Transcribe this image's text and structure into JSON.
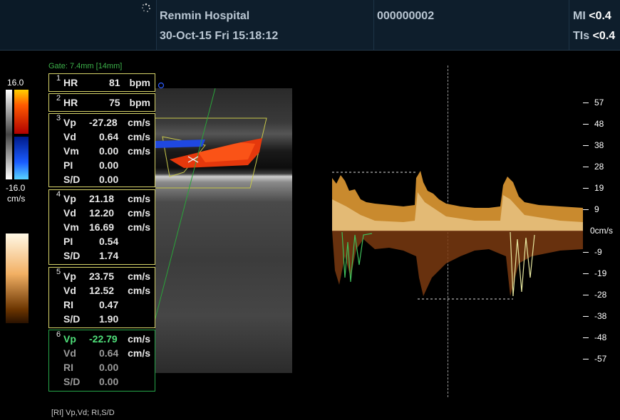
{
  "header": {
    "hospital": "Renmin Hospital",
    "datetime": "30-Oct-15 Fri 15:18:12",
    "patient_id": "000000002",
    "mi_label": "MI",
    "mi_value": "<0.4",
    "tis_label": "TIs",
    "tis_value": "<0.4"
  },
  "gate": "Gate: 7.4mm [14mm]",
  "color_bar": {
    "max": "16.0",
    "min": "-16.0",
    "unit": "cm/s"
  },
  "measurements": [
    {
      "index": "1",
      "rows": [
        {
          "label": "HR",
          "value": "81",
          "unit": "bpm"
        }
      ]
    },
    {
      "index": "2",
      "rows": [
        {
          "label": "HR",
          "value": "75",
          "unit": "bpm"
        }
      ]
    },
    {
      "index": "3",
      "rows": [
        {
          "label": "Vp",
          "value": "-27.28",
          "unit": "cm/s"
        },
        {
          "label": "Vd",
          "value": "0.64",
          "unit": "cm/s"
        },
        {
          "label": "Vm",
          "value": "0.00",
          "unit": "cm/s"
        },
        {
          "label": "PI",
          "value": "0.00",
          "unit": ""
        },
        {
          "label": "S/D",
          "value": "0.00",
          "unit": ""
        }
      ]
    },
    {
      "index": "4",
      "rows": [
        {
          "label": "Vp",
          "value": "21.18",
          "unit": "cm/s"
        },
        {
          "label": "Vd",
          "value": "12.20",
          "unit": "cm/s"
        },
        {
          "label": "Vm",
          "value": "16.69",
          "unit": "cm/s"
        },
        {
          "label": "PI",
          "value": "0.54",
          "unit": ""
        },
        {
          "label": "S/D",
          "value": "1.74",
          "unit": ""
        }
      ]
    },
    {
      "index": "5",
      "rows": [
        {
          "label": "Vp",
          "value": "23.75",
          "unit": "cm/s"
        },
        {
          "label": "Vd",
          "value": "12.52",
          "unit": "cm/s"
        },
        {
          "label": "RI",
          "value": "0.47",
          "unit": ""
        },
        {
          "label": "S/D",
          "value": "1.90",
          "unit": ""
        }
      ]
    },
    {
      "index": "6",
      "rows": [
        {
          "label": "Vp",
          "value": "-22.79",
          "unit": "cm/s"
        },
        {
          "label": "Vd",
          "value": "0.64",
          "unit": "cm/s"
        },
        {
          "label": "RI",
          "value": "0.00",
          "unit": ""
        },
        {
          "label": "S/D",
          "value": "0.00",
          "unit": ""
        }
      ]
    }
  ],
  "velocity_scale": [
    "57",
    "48",
    "38",
    "28",
    "19",
    "9",
    "0cm/s",
    "-9",
    "-19",
    "-28",
    "-38",
    "-48",
    "-57"
  ],
  "footer": "[RI] Vp,Vd;   RI,S/D",
  "colors": {
    "yellow_box": "#d6d36a",
    "green_box": "#27a64a",
    "doppler_gold": "#e0a040"
  }
}
